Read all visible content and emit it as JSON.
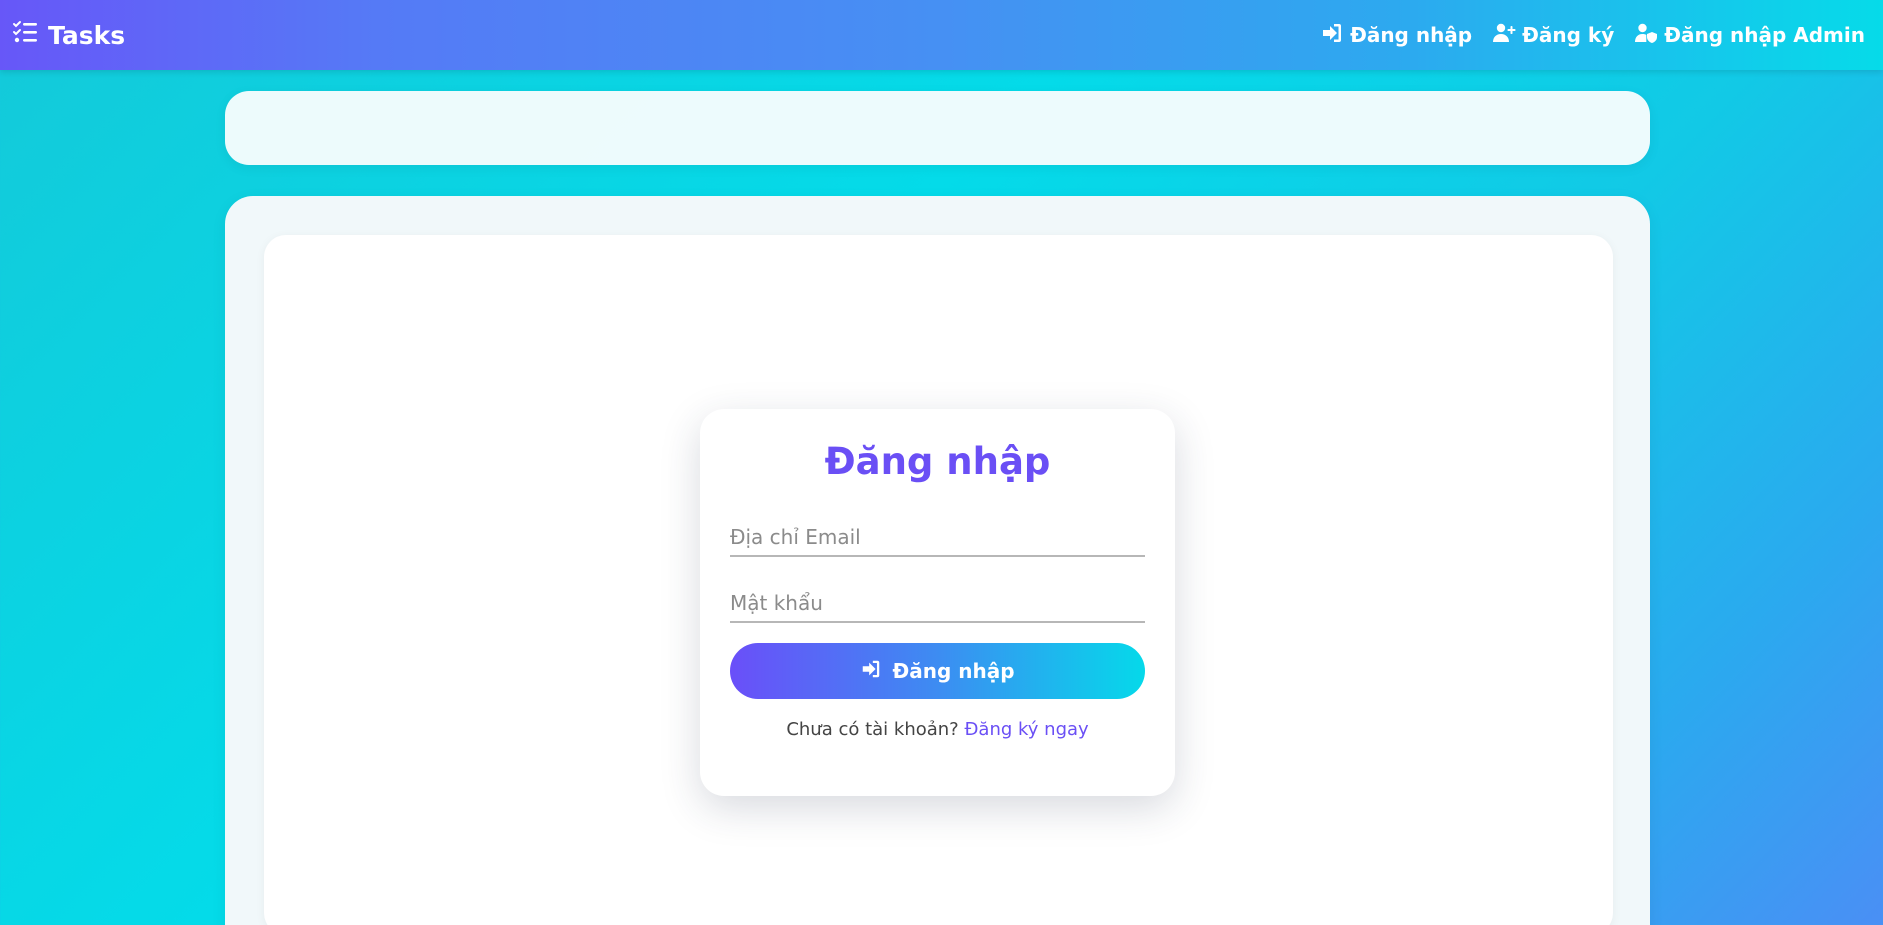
{
  "colors": {
    "accent": "#6a4ff5",
    "navbar_start": "#6757f8",
    "navbar_end": "#06dbe9",
    "background_cyan": "#04dbe9",
    "background_blue": "#4a8ff5"
  },
  "navbar": {
    "brand": {
      "label": "Tasks",
      "icon": "list-check-icon"
    },
    "links": [
      {
        "label": "Đăng nhập",
        "icon": "sign-in-icon"
      },
      {
        "label": "Đăng ký",
        "icon": "user-plus-icon"
      },
      {
        "label": "Đăng nhập Admin",
        "icon": "user-shield-icon"
      }
    ]
  },
  "login": {
    "title": "Đăng nhập",
    "email_placeholder": "Địa chỉ Email",
    "email_value": "",
    "password_placeholder": "Mật khẩu",
    "password_value": "",
    "submit_label": "Đăng nhập",
    "submit_icon": "sign-in-icon",
    "signup_prompt": "Chưa có tài khoản?",
    "signup_link": "Đăng ký ngay"
  }
}
